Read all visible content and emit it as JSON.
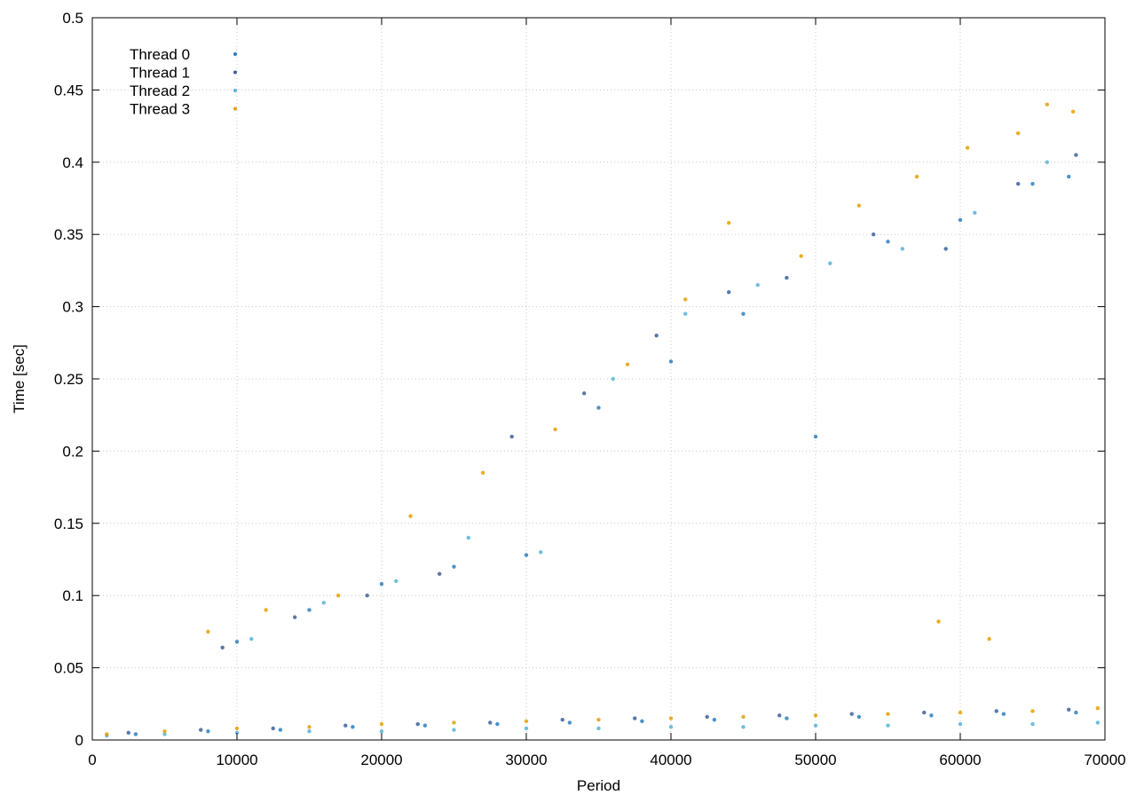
{
  "chart_data": {
    "type": "scatter",
    "title": "",
    "xlabel": "Period",
    "ylabel": "Time [sec]",
    "xlim": [
      0,
      70000
    ],
    "ylim": [
      0,
      0.5
    ],
    "x_ticks": [
      0,
      10000,
      20000,
      30000,
      40000,
      50000,
      60000,
      70000
    ],
    "x_tick_labels": [
      "0",
      "10000",
      "20000",
      "30000",
      "40000",
      "50000",
      "60000",
      "70000"
    ],
    "y_ticks": [
      0,
      0.05,
      0.1,
      0.15,
      0.2,
      0.25,
      0.3,
      0.35,
      0.4,
      0.45,
      0.5
    ],
    "y_tick_labels": [
      "0",
      "0.05",
      "0.1",
      "0.15",
      "0.2",
      "0.25",
      "0.3",
      "0.35",
      "0.4",
      "0.45",
      "0.5"
    ],
    "grid": true,
    "legend_position": "top-left",
    "series": [
      {
        "name": "Thread 0",
        "color": "#2a7fbf",
        "points": [
          [
            3000,
            0.004
          ],
          [
            8000,
            0.006
          ],
          [
            13000,
            0.007
          ],
          [
            18000,
            0.009
          ],
          [
            23000,
            0.01
          ],
          [
            28000,
            0.011
          ],
          [
            33000,
            0.012
          ],
          [
            38000,
            0.013
          ],
          [
            43000,
            0.014
          ],
          [
            48000,
            0.015
          ],
          [
            53000,
            0.016
          ],
          [
            58000,
            0.017
          ],
          [
            63000,
            0.018
          ],
          [
            68000,
            0.019
          ],
          [
            10000,
            0.068
          ],
          [
            15000,
            0.09
          ],
          [
            20000,
            0.108
          ],
          [
            25000,
            0.12
          ],
          [
            30000,
            0.128
          ],
          [
            35000,
            0.23
          ],
          [
            40000,
            0.262
          ],
          [
            45000,
            0.295
          ],
          [
            50000,
            0.21
          ],
          [
            55000,
            0.345
          ],
          [
            60000,
            0.36
          ],
          [
            65000,
            0.385
          ],
          [
            67500,
            0.39
          ]
        ]
      },
      {
        "name": "Thread 1",
        "color": "#3e5f9a",
        "points": [
          [
            2500,
            0.005
          ],
          [
            7500,
            0.007
          ],
          [
            12500,
            0.008
          ],
          [
            17500,
            0.01
          ],
          [
            22500,
            0.011
          ],
          [
            27500,
            0.012
          ],
          [
            32500,
            0.014
          ],
          [
            37500,
            0.015
          ],
          [
            42500,
            0.016
          ],
          [
            47500,
            0.017
          ],
          [
            52500,
            0.018
          ],
          [
            57500,
            0.019
          ],
          [
            62500,
            0.02
          ],
          [
            67500,
            0.021
          ],
          [
            9000,
            0.064
          ],
          [
            14000,
            0.085
          ],
          [
            19000,
            0.1
          ],
          [
            24000,
            0.115
          ],
          [
            29000,
            0.21
          ],
          [
            34000,
            0.24
          ],
          [
            39000,
            0.28
          ],
          [
            44000,
            0.31
          ],
          [
            48000,
            0.32
          ],
          [
            54000,
            0.35
          ],
          [
            59000,
            0.34
          ],
          [
            64000,
            0.385
          ],
          [
            68000,
            0.405
          ]
        ]
      },
      {
        "name": "Thread 2",
        "color": "#56b4d8",
        "points": [
          [
            1000,
            0.003
          ],
          [
            5000,
            0.004
          ],
          [
            10000,
            0.005
          ],
          [
            15000,
            0.006
          ],
          [
            20000,
            0.006
          ],
          [
            25000,
            0.007
          ],
          [
            30000,
            0.008
          ],
          [
            35000,
            0.008
          ],
          [
            40000,
            0.009
          ],
          [
            45000,
            0.009
          ],
          [
            50000,
            0.01
          ],
          [
            55000,
            0.01
          ],
          [
            60000,
            0.011
          ],
          [
            65000,
            0.011
          ],
          [
            69500,
            0.012
          ],
          [
            11000,
            0.07
          ],
          [
            16000,
            0.095
          ],
          [
            21000,
            0.11
          ],
          [
            26000,
            0.14
          ],
          [
            31000,
            0.13
          ],
          [
            36000,
            0.25
          ],
          [
            41000,
            0.295
          ],
          [
            46000,
            0.315
          ],
          [
            51000,
            0.33
          ],
          [
            56000,
            0.34
          ],
          [
            61000,
            0.365
          ],
          [
            66000,
            0.4
          ]
        ]
      },
      {
        "name": "Thread 3",
        "color": "#e69f00",
        "points": [
          [
            1000,
            0.004
          ],
          [
            5000,
            0.006
          ],
          [
            10000,
            0.008
          ],
          [
            15000,
            0.009
          ],
          [
            20000,
            0.011
          ],
          [
            25000,
            0.012
          ],
          [
            30000,
            0.013
          ],
          [
            35000,
            0.014
          ],
          [
            40000,
            0.015
          ],
          [
            45000,
            0.016
          ],
          [
            50000,
            0.017
          ],
          [
            55000,
            0.018
          ],
          [
            60000,
            0.019
          ],
          [
            65000,
            0.02
          ],
          [
            69500,
            0.022
          ],
          [
            8000,
            0.075
          ],
          [
            12000,
            0.09
          ],
          [
            17000,
            0.1
          ],
          [
            22000,
            0.155
          ],
          [
            27000,
            0.185
          ],
          [
            32000,
            0.215
          ],
          [
            37000,
            0.26
          ],
          [
            41000,
            0.305
          ],
          [
            44000,
            0.358
          ],
          [
            49000,
            0.335
          ],
          [
            53000,
            0.37
          ],
          [
            57000,
            0.39
          ],
          [
            60500,
            0.41
          ],
          [
            64000,
            0.42
          ],
          [
            66000,
            0.44
          ],
          [
            67800,
            0.435
          ],
          [
            58500,
            0.082
          ],
          [
            62000,
            0.07
          ]
        ]
      }
    ]
  }
}
